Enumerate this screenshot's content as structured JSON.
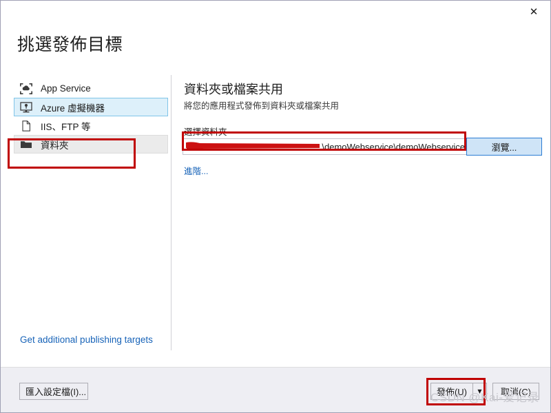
{
  "window": {
    "title": "挑選發佈目標",
    "close_label": "✕"
  },
  "sidebar": {
    "items": [
      {
        "label": "App Service",
        "icon": "app-service-icon",
        "state": "normal"
      },
      {
        "label": "Azure 虛擬機器",
        "icon": "virtual-machine-icon",
        "state": "selected"
      },
      {
        "label": "IIS、FTP 等",
        "icon": "document-icon",
        "state": "normal"
      },
      {
        "label": "資料夾",
        "icon": "folder-icon",
        "state": "hovered"
      }
    ],
    "additional_targets_link": "Get additional publishing targets"
  },
  "panel": {
    "heading": "資料夾或檔案共用",
    "subheading": "將您的應用程式發佈到資料夾或檔案共用",
    "field_label": "選擇資料夾",
    "path_value": "\\demoWebservice\\demoWebservice",
    "path_redacted": true,
    "browse_label": "瀏覽...",
    "advanced_link": "進階..."
  },
  "footer": {
    "import_label": "匯入設定檔(I)...",
    "publish_label": "發佈(U)",
    "publish_arrow": "▼",
    "cancel_label": "取消(C)"
  },
  "watermark": {
    "text": "CSDN @Kai-爱记录"
  },
  "colors": {
    "accent_link": "#1763b8",
    "selected_bg": "#ddf0fa",
    "selected_border": "#7fc4e8",
    "browse_bg": "#cfe4f7",
    "browse_border": "#2b7cd3",
    "annotation_red": "#c00000",
    "footer_bg": "#eeeef3",
    "window_border": "#9fa0b4",
    "watermark_gray": "#c9c9cf"
  }
}
